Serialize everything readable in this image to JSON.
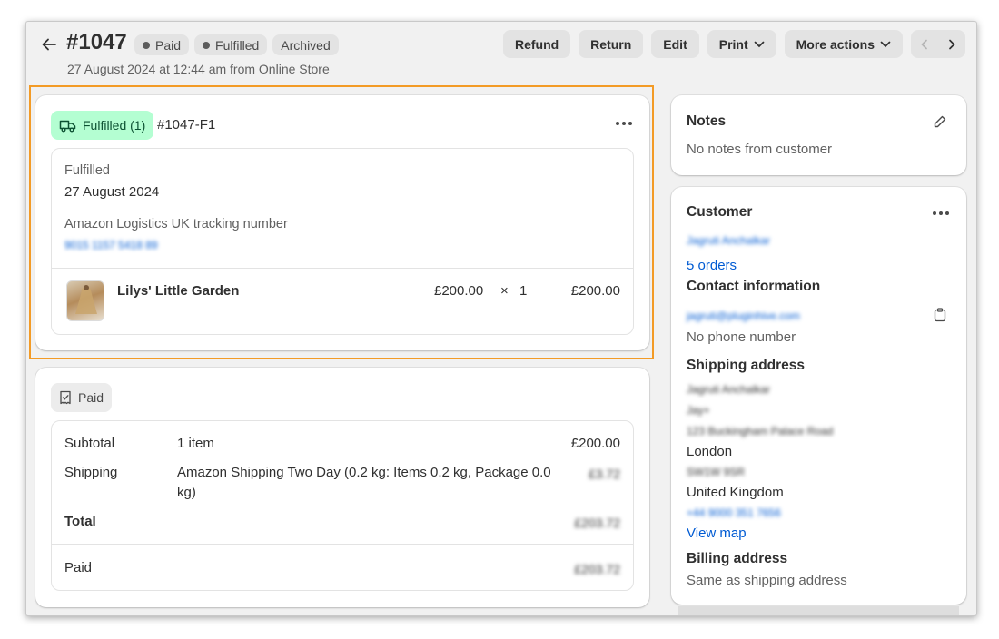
{
  "header": {
    "order_number": "#1047",
    "badges": [
      "Paid",
      "Fulfilled",
      "Archived"
    ],
    "subtitle": "27 August 2024 at 12:44 am from Online Store",
    "actions": {
      "refund": "Refund",
      "return": "Return",
      "edit": "Edit",
      "print": "Print",
      "more": "More actions"
    }
  },
  "fulfillment": {
    "status_pill": "Fulfilled (1)",
    "fulfillment_id": "#1047-F1",
    "status_label": "Fulfilled",
    "date": "27 August 2024",
    "tracking_label": "Amazon Logistics UK tracking number",
    "tracking_number": "9015 1157 5418 89",
    "item": {
      "name": "Lilys' Little Garden",
      "price": "£200.00",
      "times": "×",
      "quantity": "1",
      "total": "£200.00"
    }
  },
  "payment": {
    "status_pill": "Paid",
    "subtotal_label": "Subtotal",
    "subtotal_items": "1 item",
    "subtotal_value": "£200.00",
    "shipping_label": "Shipping",
    "shipping_desc_line1": "Amazon Shipping Two Day (0.2 kg: Items 0.2 kg, Package 0.0",
    "shipping_desc_line2": "kg)",
    "shipping_value": "£3.72",
    "total_label": "Total",
    "total_value": "£203.72",
    "paid_label": "Paid",
    "paid_value": "£203.72"
  },
  "notes": {
    "title": "Notes",
    "text": "No notes from customer"
  },
  "customer": {
    "title": "Customer",
    "name": "Jagruti Anchalkar",
    "orders": "5 orders",
    "contact_title": "Contact information",
    "email": "jagruti@pluginhive.com",
    "phone": "No phone number",
    "shipping_title": "Shipping address",
    "addr_name": "Jagruti Anchalkar",
    "addr_company": "Jay+",
    "addr_street": "123 Buckingham Palace Road",
    "addr_city": "London",
    "addr_postcode": "SW1W 9SR",
    "addr_country": "United Kingdom",
    "addr_phone": "+44 9000 351 7656",
    "view_map": "View map",
    "billing_title": "Billing address",
    "billing_text": "Same as shipping address"
  },
  "colors": {
    "accent_link": "#005bd3",
    "fulfilled_green": "#b4fed2",
    "highlight_orange": "#f39b26"
  }
}
